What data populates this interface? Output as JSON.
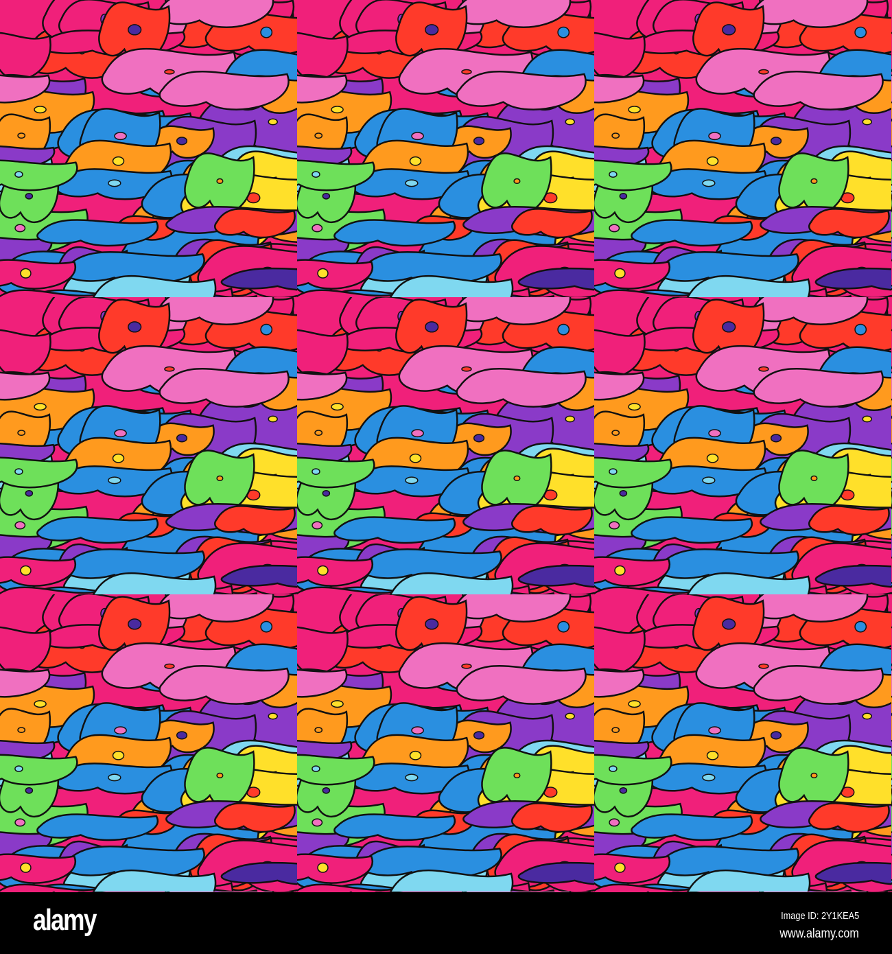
{
  "watermark": {
    "logo": "alamy",
    "image_id": "Image ID: 2Y1KEA5",
    "url": "www.alamy.com"
  },
  "palette": [
    "#f0207a",
    "#ff3a2a",
    "#ff9a1e",
    "#2a8fe0",
    "#8a3ac8",
    "#6ee05a",
    "#7fd8f0",
    "#ffe02a",
    "#f070c0",
    "#4a2aa0"
  ]
}
